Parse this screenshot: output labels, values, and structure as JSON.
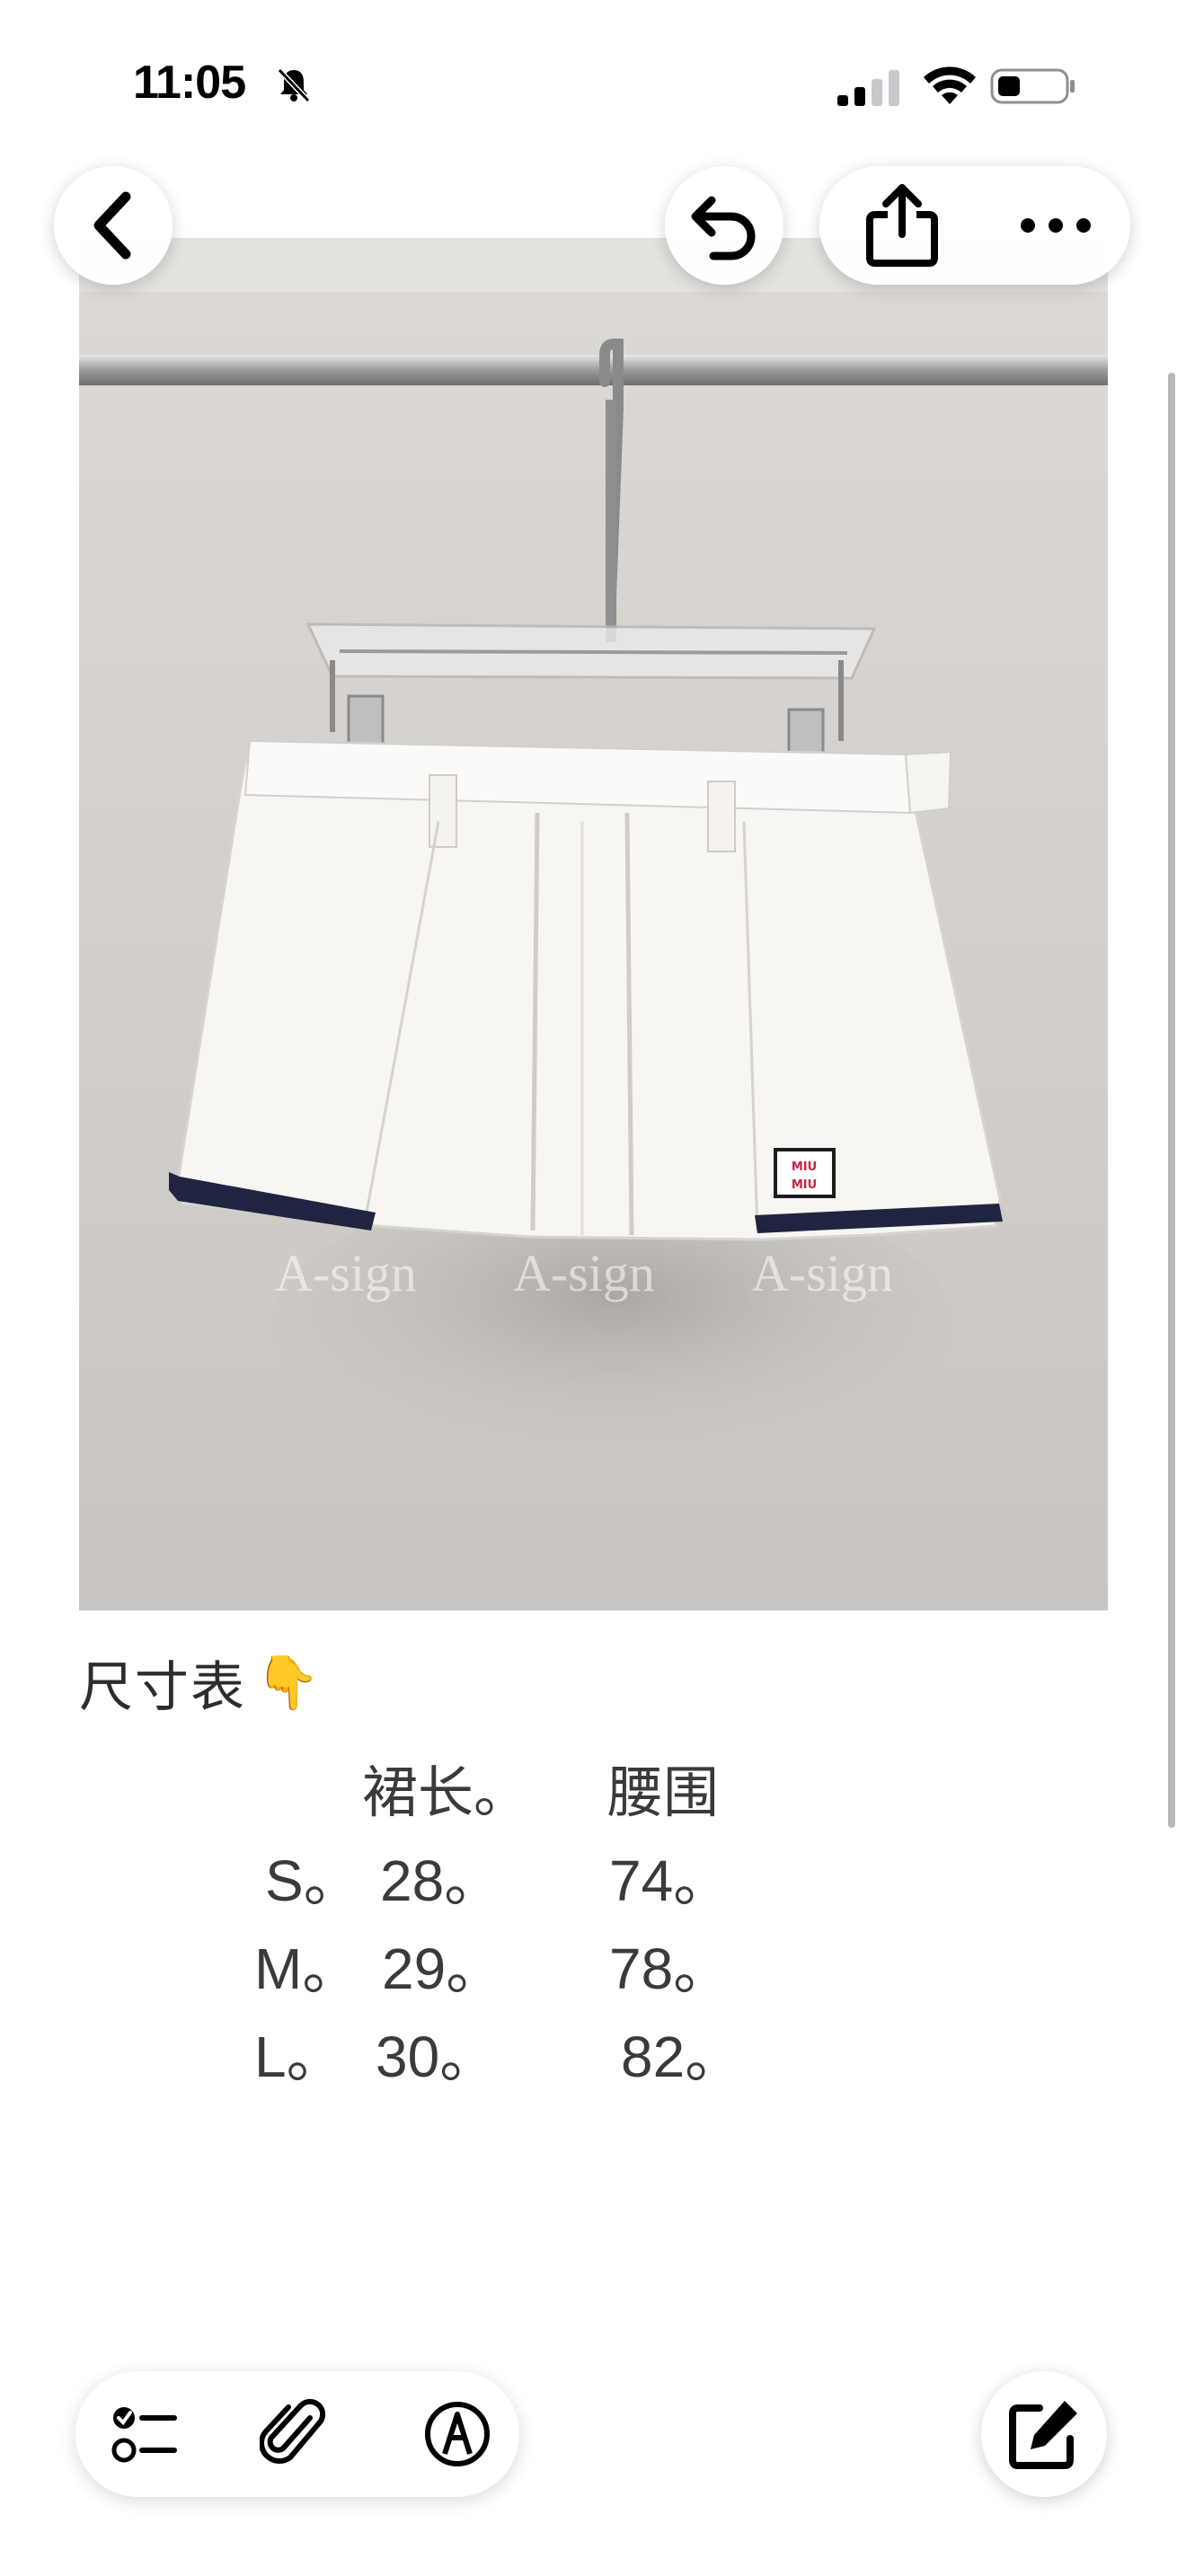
{
  "status_bar": {
    "time": "11:05",
    "icons": [
      "bell-slash-icon",
      "cellular-signal-icon",
      "wifi-icon",
      "battery-icon"
    ]
  },
  "toolbar": {
    "back_icon": "chevron-left-icon",
    "undo_icon": "undo-arrow-icon",
    "share_icon": "share-icon",
    "more_icon": "ellipsis-icon"
  },
  "photo": {
    "description_icon": "skirt-photo",
    "watermark": [
      "A-sign",
      "A-sign",
      "A-sign"
    ],
    "logo_text": "MIU MIU"
  },
  "note": {
    "heading": "尺寸表",
    "heading_emoji": "👇",
    "table": {
      "headers": [
        "裙长。",
        "腰围"
      ],
      "rows": [
        {
          "size": "S。",
          "length": "28。",
          "waist": "74。"
        },
        {
          "size": "M。",
          "length": "29。",
          "waist": "78。"
        },
        {
          "size": "L。",
          "length": "30。",
          "waist": "82。"
        }
      ]
    }
  },
  "bottom_toolbar": {
    "icons": [
      "checklist-icon",
      "paperclip-icon",
      "markup-icon",
      "compose-icon"
    ]
  }
}
